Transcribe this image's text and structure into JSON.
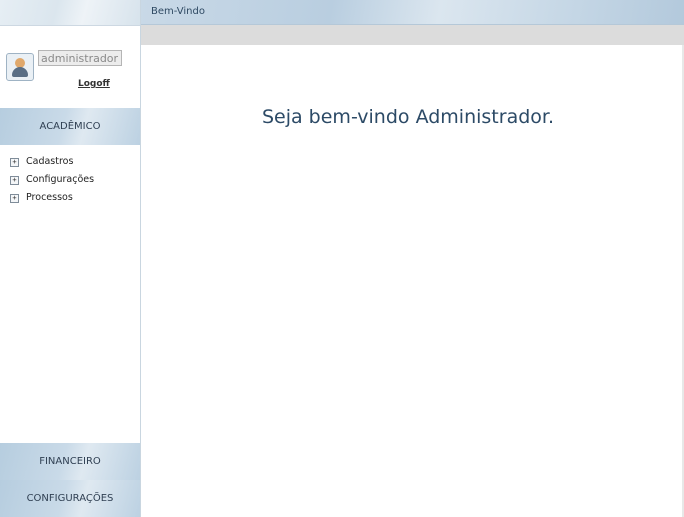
{
  "topbar": {
    "title": "Bem-Vindo"
  },
  "user": {
    "username": "administrador",
    "logoff_label": "Logoff"
  },
  "sidebar": {
    "sections": {
      "academico": "ACADÊMICO",
      "financeiro": "FINANCEIRO",
      "configuracoes": "CONFIGURAÇÕES"
    },
    "tree": [
      {
        "label": "Cadastros"
      },
      {
        "label": "Configurações"
      },
      {
        "label": "Processos"
      }
    ]
  },
  "main": {
    "welcome": "Seja bem-vindo Administrador."
  },
  "icons": {
    "user": "user-avatar-icon",
    "expand": "plus-box-icon"
  }
}
